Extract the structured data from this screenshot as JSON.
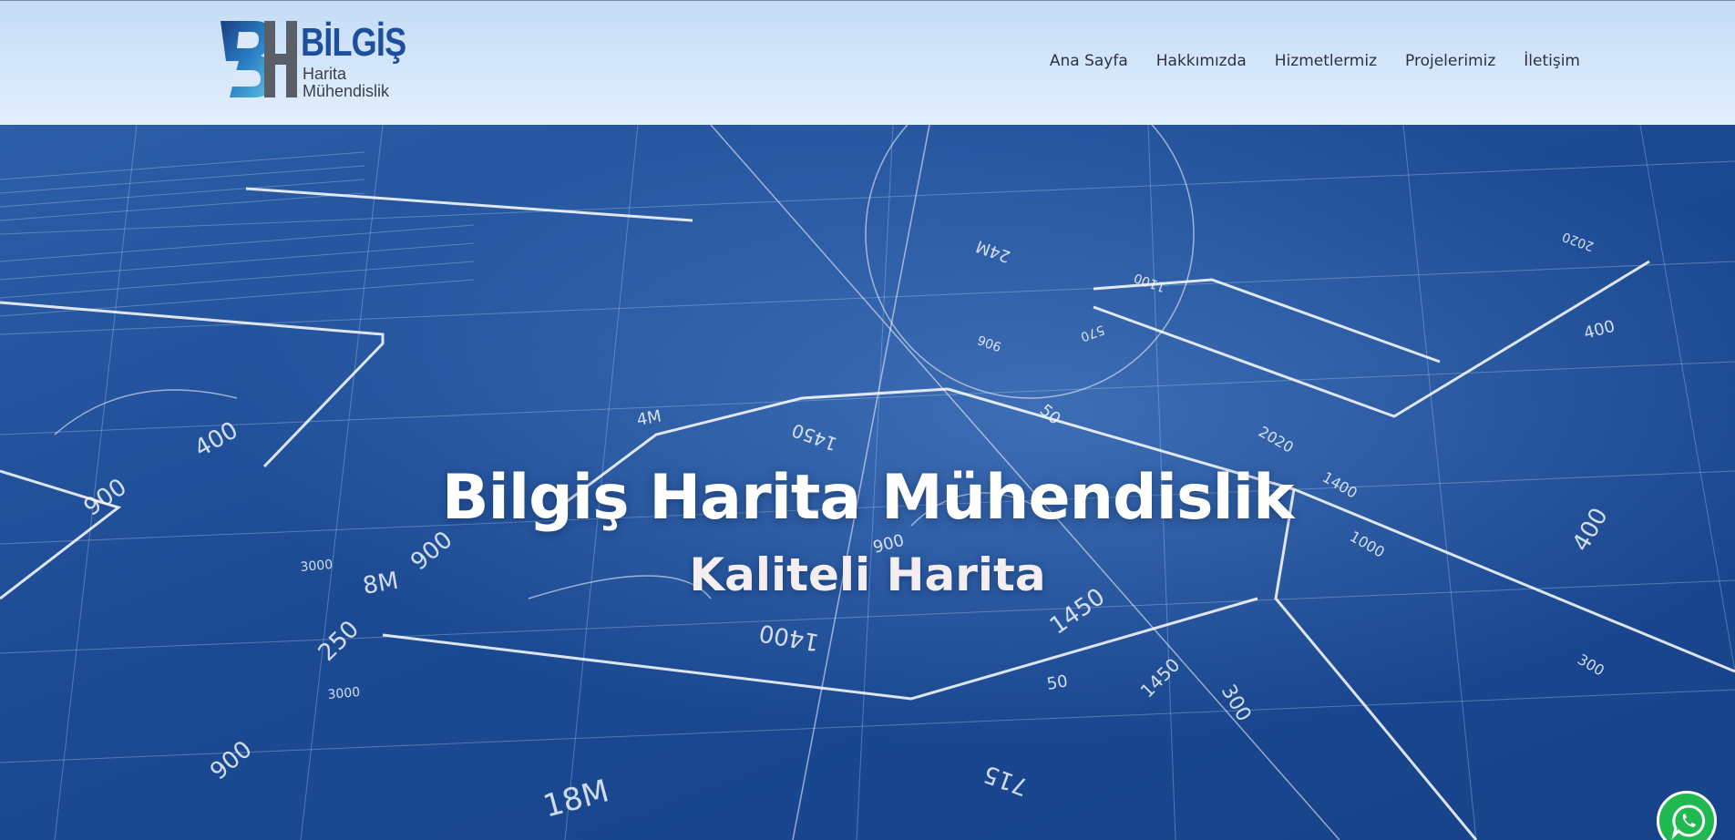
{
  "header": {
    "logo": {
      "title": "BİLGİŞ",
      "line1": "Harita",
      "line2": "Mühendislik"
    },
    "nav": [
      {
        "label": "Ana Sayfa"
      },
      {
        "label": "Hakkımızda"
      },
      {
        "label": "Hizmetlermiz"
      },
      {
        "label": "Projelerimiz"
      },
      {
        "label": "İletişim"
      }
    ]
  },
  "hero": {
    "title": "Bilgiş Harita Mühendislik",
    "subtitle": "Kaliteli Harita",
    "blueprint_labels": [
      "400",
      "900",
      "900",
      "250",
      "900",
      "8M",
      "3000",
      "3000",
      "1450",
      "1400",
      "1450",
      "4M",
      "50",
      "900",
      "570",
      "1100",
      "906",
      "2020",
      "1400",
      "1000",
      "400",
      "715",
      "300",
      "18M",
      "24M",
      "1450",
      "50",
      "400",
      "2020",
      "300"
    ]
  },
  "colors": {
    "header_bg": "#cfe3f9",
    "brand_blue": "#1d4f9e",
    "hero_blue": "#1e4a8e",
    "whatsapp_green": "#1fb851"
  },
  "icons": {
    "whatsapp": "whatsapp-icon"
  }
}
